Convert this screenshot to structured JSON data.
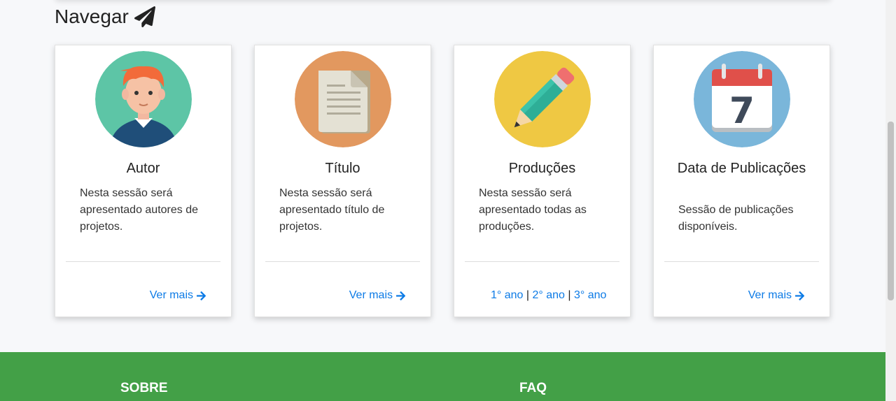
{
  "section": {
    "title": "Navegar",
    "icon": "paper-plane-icon"
  },
  "cards": [
    {
      "title": "Autor",
      "text": "Nesta sessão será apresentado autores de projetos.",
      "link": "Ver mais",
      "icon": "person-avatar-icon",
      "bg": "#5dc5a6"
    },
    {
      "title": "Título",
      "text": "Nesta sessão será apresentado título de projetos.",
      "link": "Ver mais",
      "icon": "document-icon",
      "bg": "#e2985f"
    },
    {
      "title": "Produções",
      "text": "Nesta sessão será apresentado todas as produções.",
      "years": [
        "1° ano",
        "2° ano",
        "3° ano"
      ],
      "separator": "|",
      "icon": "pencil-icon",
      "bg": "#efc843"
    },
    {
      "title": "Data de Publicações",
      "text": "Sessão de publicações disponíveis.",
      "link": "Ver mais",
      "icon": "calendar-icon",
      "bg": "#7ab6da",
      "calendar_day": "7"
    }
  ],
  "footer": {
    "col1": "SOBRE",
    "col2": "FAQ",
    "color": "#43a047"
  },
  "colors": {
    "link": "#0d7be6"
  }
}
